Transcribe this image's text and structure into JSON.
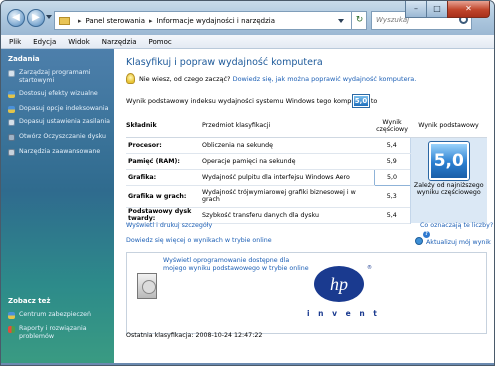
{
  "address": {
    "crumbs": [
      "Panel sterowania",
      "Informacje wydajności i narzędzia"
    ],
    "search_placeholder": "Wyszukaj"
  },
  "window_controls": {
    "minimize": "–",
    "maximize": "□",
    "close": "✕"
  },
  "menu": [
    "Plik",
    "Edycja",
    "Widok",
    "Narzędzia",
    "Pomoc"
  ],
  "sidebar": {
    "tasks_heading": "Zadania",
    "tasks": [
      {
        "label": "Zarządzaj programami startowymi",
        "icon": "gear-icon"
      },
      {
        "label": "Dostosuj efekty wizualne",
        "icon": "shield-icon"
      },
      {
        "label": "Dopasuj opcje indeksowania",
        "icon": "shield-icon"
      },
      {
        "label": "Dopasuj ustawienia zasilania",
        "icon": "battery-icon"
      },
      {
        "label": "Otwórz Oczyszczanie dysku",
        "icon": "disk-icon"
      },
      {
        "label": "Narzędzia zaawansowane",
        "icon": "tools-icon"
      }
    ],
    "see_also_heading": "Zobacz też",
    "see_also": [
      {
        "label": "Centrum zabezpieczeń",
        "icon": "security-center-icon"
      },
      {
        "label": "Raporty i rozwiązania problemów",
        "icon": "flag-icon"
      }
    ]
  },
  "main": {
    "title": "Klasyfikuj i popraw wydajność komputera",
    "tip_question": "Nie wiesz, od czego zacząć?",
    "tip_link": "Dowiedz się, jak można poprawić wydajność komputera.",
    "base_score_label": "Wynik podstawowy indeksu wydajności systemu Windows tego komputera to",
    "base_score": "5,0",
    "table": {
      "headers": [
        "Składnik",
        "Przedmiot klasyfikacji",
        "Wynik częściowy",
        "Wynik podstawowy"
      ],
      "rows": [
        {
          "component": "Procesor:",
          "description": "Obliczenia na sekundę",
          "score": "5,4"
        },
        {
          "component": "Pamięć (RAM):",
          "description": "Operacje pamięci na sekundę",
          "score": "5,9"
        },
        {
          "component": "Grafika:",
          "description": "Wydajność pulpitu dla interfejsu Windows Aero",
          "score": "5,0"
        },
        {
          "component": "Grafika w grach:",
          "description": "Wydajność trójwymiarowej grafiki biznesowej i w grach",
          "score": "5,3"
        },
        {
          "component": "Podstawowy dysk twardy:",
          "description": "Szybkość transferu danych dla dysku",
          "score": "5,4"
        }
      ],
      "base_note": "Zależy od najniższego wyniku częściowego"
    },
    "links": {
      "print": "Wyświetl i drukuj szczegóły",
      "meaning": "Co oznaczają te liczby?",
      "learn_online": "Dowiedz się więcej o wynikach w trybie online",
      "update": "Aktualizuj mój wynik"
    },
    "promo": {
      "text": "Wyświetl oprogramowanie dostępne dla mojego wyniku podstawowego w trybie online",
      "brand": "hp",
      "brand_tagline": "i n v e n t",
      "brand_color": "#1a3a8f"
    },
    "last_rating": "Ostatnia klasyfikacja: 2008-10-24 12:47:22"
  },
  "colors": {
    "accent": "#1e5a9a",
    "link": "#1c5fb5",
    "sidebar_top": "#4d7fab",
    "sidebar_bottom": "#3a9b82"
  }
}
